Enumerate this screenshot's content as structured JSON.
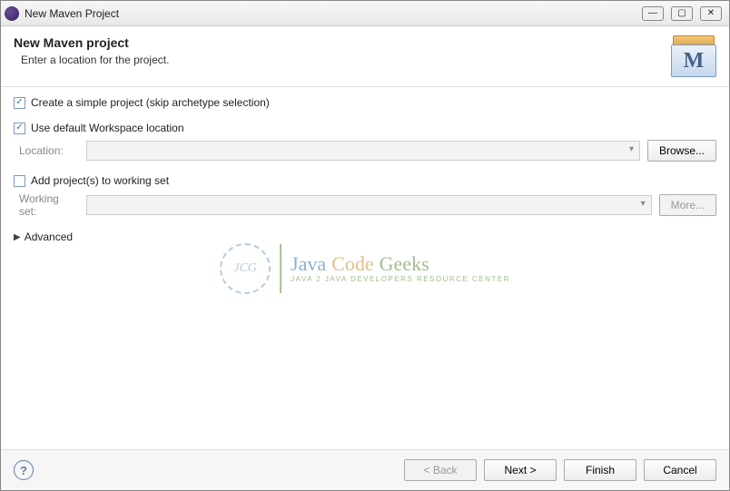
{
  "window": {
    "title": "New Maven Project"
  },
  "header": {
    "title": "New Maven project",
    "subtitle": "Enter a location for the project.",
    "icon_letter": "M"
  },
  "form": {
    "simple_project": {
      "label": "Create a simple project (skip archetype selection)",
      "checked": true
    },
    "default_workspace": {
      "label": "Use default Workspace location",
      "checked": true
    },
    "location": {
      "label": "Location:",
      "value": "",
      "browse_label": "Browse..."
    },
    "working_set_chk": {
      "label": "Add project(s) to working set",
      "checked": false
    },
    "working_set": {
      "label": "Working set:",
      "value": "",
      "more_label": "More..."
    },
    "advanced": {
      "label": "Advanced"
    }
  },
  "buttons": {
    "back": "< Back",
    "next": "Next >",
    "finish": "Finish",
    "cancel": "Cancel"
  },
  "watermark": {
    "badge": "JCG",
    "word1": "Java",
    "word2": "Code",
    "word3": "Geeks",
    "sub": "Java 2 Java Developers Resource Center"
  }
}
